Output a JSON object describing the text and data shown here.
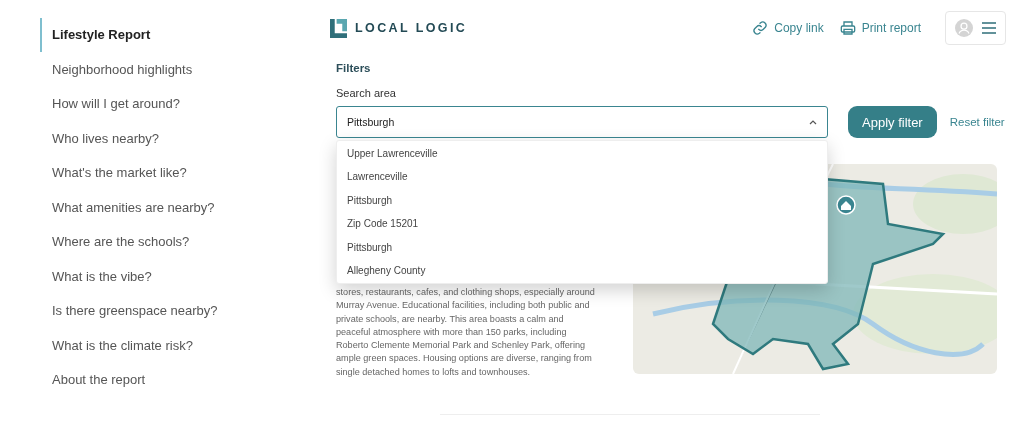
{
  "sidebar": {
    "items": [
      {
        "label": "Lifestyle Report",
        "selected": true
      },
      {
        "label": "Neighborhood highlights",
        "selected": false
      },
      {
        "label": "How will I get around?",
        "selected": false
      },
      {
        "label": "Who lives nearby?",
        "selected": false
      },
      {
        "label": "What's the market like?",
        "selected": false
      },
      {
        "label": "What amenities are nearby?",
        "selected": false
      },
      {
        "label": "Where are the schools?",
        "selected": false
      },
      {
        "label": "What is the vibe?",
        "selected": false
      },
      {
        "label": "Is there greenspace nearby?",
        "selected": false
      },
      {
        "label": "What is the climate risk?",
        "selected": false
      },
      {
        "label": "About the report",
        "selected": false
      }
    ]
  },
  "header": {
    "logo": "LOCAL LOGIC",
    "actions": [
      "Copy link",
      "Print report"
    ]
  },
  "filters": {
    "title": "Filters",
    "label": "Search area",
    "value": "Pittsburgh",
    "expanded": true,
    "options": [
      "Upper Lawrenceville",
      "Lawrenceville",
      "Pittsburgh",
      "Zip Code 15201",
      "Pittsburgh",
      "Allegheny County"
    ],
    "apply": "Apply filter",
    "reset": "Reset filter"
  },
  "description": "stores, restaurants, cafes, and clothing shops, especially around Murray Avenue. Educational facilities, including both public and private schools, are nearby. This area boasts a calm and peaceful atmosphere with more than 150 parks, including Roberto Clemente Memorial Park and Schenley Park, offering ample green spaces. Housing options are diverse, ranging from single detached homes to lofts and townhouses."
}
